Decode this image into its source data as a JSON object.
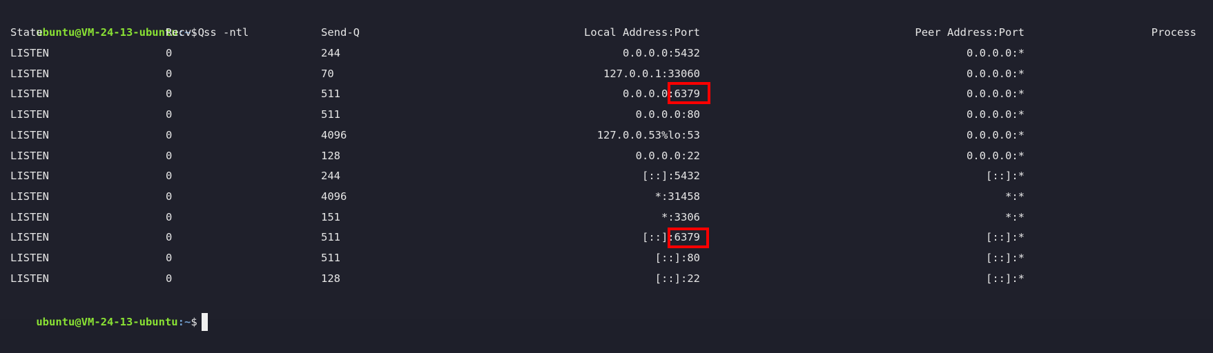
{
  "terminal": {
    "user_host": "ubuntu@VM-24-13-ubuntu",
    "path_sep": ":~",
    "prompt_symbol": "$",
    "command": "ss -ntl"
  },
  "headers": {
    "state": "State",
    "recv_q": "Recv-Q",
    "send_q": "Send-Q",
    "local": "Local Address:Port",
    "peer": "Peer Address:Port",
    "process": "Process"
  },
  "rows": [
    {
      "state": "LISTEN",
      "recv_q": "0",
      "send_q": "244",
      "local": "0.0.0.0:5432",
      "peer": "0.0.0.0:*"
    },
    {
      "state": "LISTEN",
      "recv_q": "0",
      "send_q": "70",
      "local": "127.0.0.1:33060",
      "peer": "0.0.0.0:*"
    },
    {
      "state": "LISTEN",
      "recv_q": "0",
      "send_q": "511",
      "local": "0.0.0.0:6379",
      "peer": "0.0.0.0:*"
    },
    {
      "state": "LISTEN",
      "recv_q": "0",
      "send_q": "511",
      "local": "0.0.0.0:80",
      "peer": "0.0.0.0:*"
    },
    {
      "state": "LISTEN",
      "recv_q": "0",
      "send_q": "4096",
      "local": "127.0.0.53%lo:53",
      "peer": "0.0.0.0:*"
    },
    {
      "state": "LISTEN",
      "recv_q": "0",
      "send_q": "128",
      "local": "0.0.0.0:22",
      "peer": "0.0.0.0:*"
    },
    {
      "state": "LISTEN",
      "recv_q": "0",
      "send_q": "244",
      "local": "[::]:5432",
      "peer": "[::]:*"
    },
    {
      "state": "LISTEN",
      "recv_q": "0",
      "send_q": "4096",
      "local": "*:31458",
      "peer": "*:*"
    },
    {
      "state": "LISTEN",
      "recv_q": "0",
      "send_q": "151",
      "local": "*:3306",
      "peer": "*:*"
    },
    {
      "state": "LISTEN",
      "recv_q": "0",
      "send_q": "511",
      "local": "[::]:6379",
      "peer": "[::]:*"
    },
    {
      "state": "LISTEN",
      "recv_q": "0",
      "send_q": "511",
      "local": "[::]:80",
      "peer": "[::]:*"
    },
    {
      "state": "LISTEN",
      "recv_q": "0",
      "send_q": "128",
      "local": "[::]:22",
      "peer": "[::]:*"
    }
  ],
  "highlight_color": "#ff0000"
}
